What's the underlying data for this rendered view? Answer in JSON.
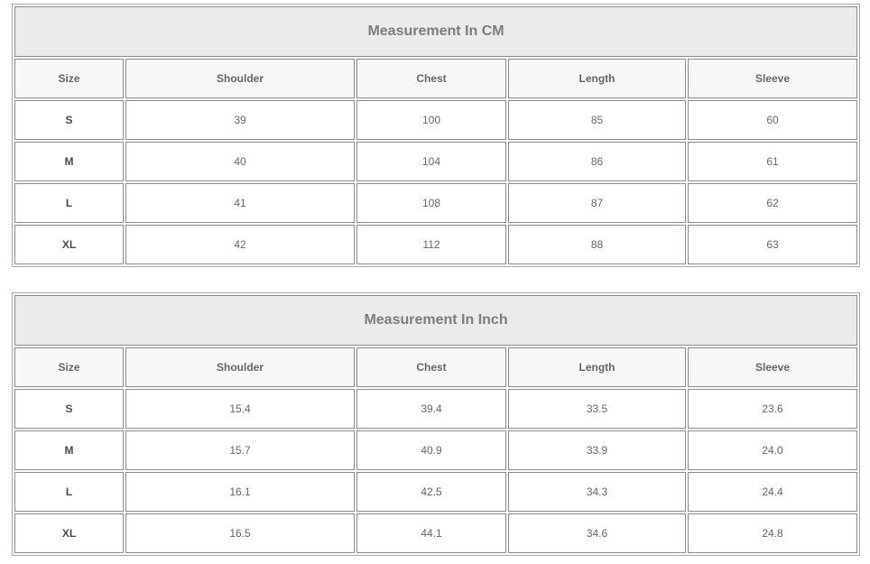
{
  "tables": [
    {
      "title": "Measurement In CM",
      "headers": [
        "Size",
        "Shoulder",
        "Chest",
        "Length",
        "Sleeve"
      ],
      "rows": [
        {
          "size": "S",
          "values": [
            "39",
            "100",
            "85",
            "60"
          ]
        },
        {
          "size": "M",
          "values": [
            "40",
            "104",
            "86",
            "61"
          ]
        },
        {
          "size": "L",
          "values": [
            "41",
            "108",
            "87",
            "62"
          ]
        },
        {
          "size": "XL",
          "values": [
            "42",
            "112",
            "88",
            "63"
          ]
        }
      ]
    },
    {
      "title": "Measurement In Inch",
      "headers": [
        "Size",
        "Shoulder",
        "Chest",
        "Length",
        "Sleeve"
      ],
      "rows": [
        {
          "size": "S",
          "values": [
            "15.4",
            "39.4",
            "33.5",
            "23.6"
          ]
        },
        {
          "size": "M",
          "values": [
            "15.7",
            "40.9",
            "33.9",
            "24.0"
          ]
        },
        {
          "size": "L",
          "values": [
            "16.1",
            "42.5",
            "34.3",
            "24.4"
          ]
        },
        {
          "size": "XL",
          "values": [
            "16.5",
            "44.1",
            "34.6",
            "24.8"
          ]
        }
      ]
    }
  ]
}
